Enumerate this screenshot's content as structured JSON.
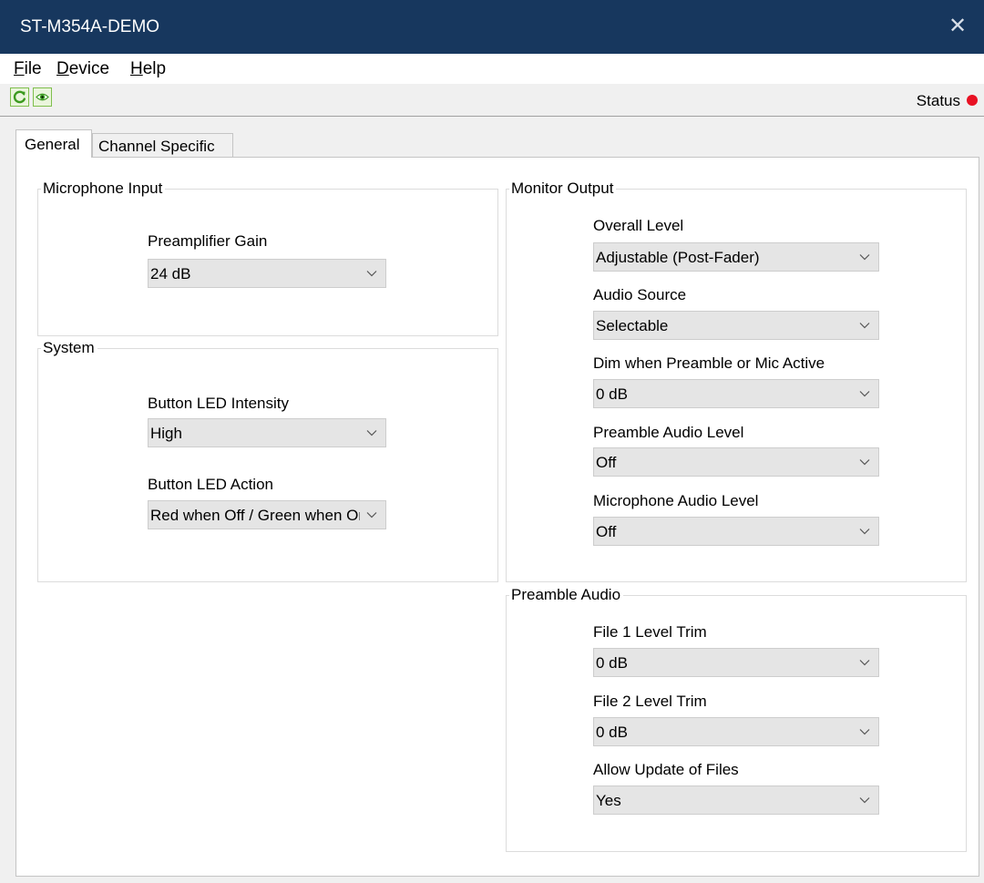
{
  "window": {
    "title": "ST-M354A-DEMO",
    "close_glyph": "✕"
  },
  "menu": [
    {
      "mnemonic": "F",
      "rest": "ile"
    },
    {
      "mnemonic": "D",
      "rest": "evice"
    },
    {
      "mnemonic": "H",
      "rest": "elp"
    }
  ],
  "toolbar": {
    "refresh_icon": "refresh-icon",
    "view_icon": "eye-icon",
    "status_label": "Status",
    "status_color": "#e81123"
  },
  "tabs": [
    {
      "label": "General",
      "active": true
    },
    {
      "label": "Channel Specific",
      "active": false
    }
  ],
  "general": {
    "microphone_input": {
      "title": "Microphone Input",
      "preamp_gain": {
        "label": "Preamplifier Gain",
        "value": "24 dB"
      }
    },
    "system": {
      "title": "System",
      "led_intensity": {
        "label": "Button LED Intensity",
        "value": "High"
      },
      "led_action": {
        "label": "Button LED Action",
        "value": "Red when Off / Green when On"
      }
    },
    "monitor_output": {
      "title": "Monitor Output",
      "overall_level": {
        "label": "Overall Level",
        "value": "Adjustable (Post-Fader)"
      },
      "audio_source": {
        "label": "Audio Source",
        "value": "Selectable"
      },
      "dim_when_active": {
        "label": "Dim when Preamble or Mic Active",
        "value": "0 dB"
      },
      "preamble_audio_level": {
        "label": "Preamble Audio Level",
        "value": "Off"
      },
      "microphone_audio_level": {
        "label": "Microphone Audio Level",
        "value": "Off"
      }
    },
    "preamble_audio": {
      "title": "Preamble Audio",
      "file1_trim": {
        "label": "File 1 Level Trim",
        "value": "0 dB"
      },
      "file2_trim": {
        "label": "File 2 Level Trim",
        "value": "0 dB"
      },
      "allow_update": {
        "label": "Allow Update of Files",
        "value": "Yes"
      }
    }
  }
}
